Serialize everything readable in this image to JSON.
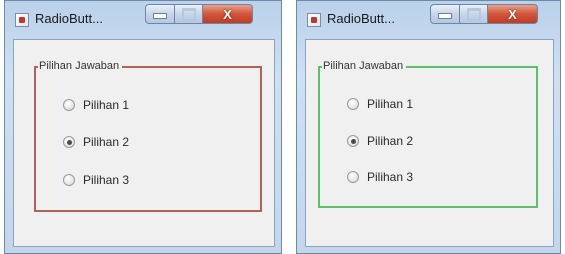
{
  "windows": [
    {
      "title": "RadioButt...",
      "caption_close": "X",
      "group_title": "Pilihan Jawaban",
      "border_color": "#b0625d",
      "options": [
        {
          "label": "Pilihan 1",
          "checked": false
        },
        {
          "label": "Pilihan 2",
          "checked": true
        },
        {
          "label": "Pilihan 3",
          "checked": false
        }
      ]
    },
    {
      "title": "RadioButt...",
      "caption_close": "X",
      "group_title": "Pilihan Jawaban",
      "border_color": "#5dbf6a",
      "options": [
        {
          "label": "Pilihan 1",
          "checked": false
        },
        {
          "label": "Pilihan 2",
          "checked": true
        },
        {
          "label": "Pilihan 3",
          "checked": false
        }
      ]
    }
  ]
}
